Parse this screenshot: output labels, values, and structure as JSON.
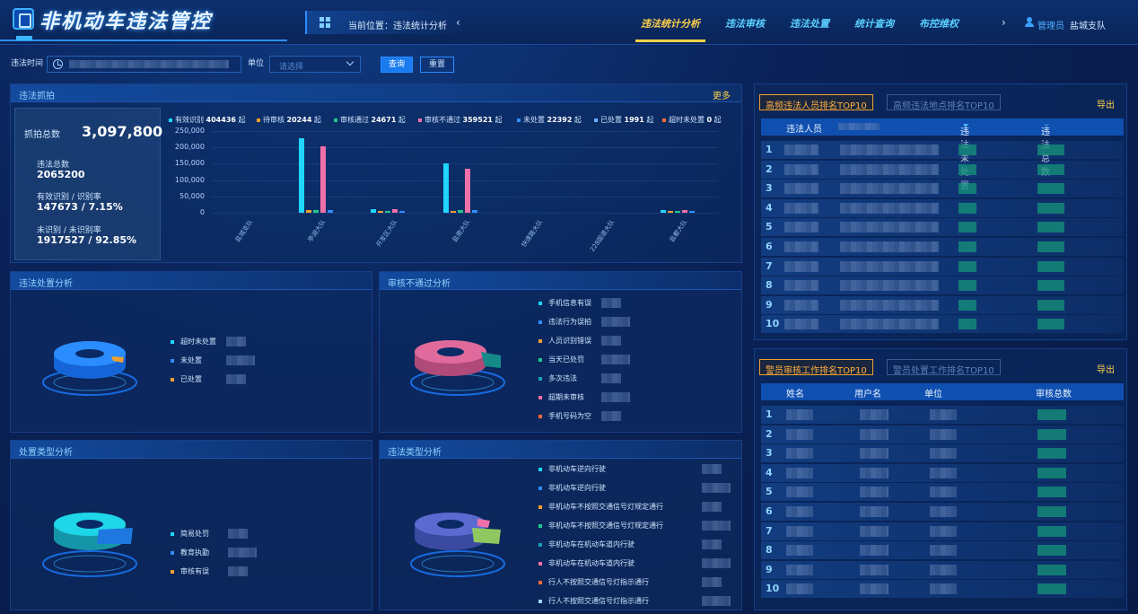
{
  "app": {
    "title": "非机动车违法管控"
  },
  "breadcrumb": {
    "label": "当前位置：",
    "current": "违法统计分析"
  },
  "nav": {
    "tabs": [
      "违法统计分析",
      "违法审核",
      "违法处置",
      "统计查询",
      "布控维权"
    ],
    "active": 0
  },
  "user": {
    "role": "管理员",
    "unit": "盐城支队"
  },
  "filters": {
    "time_label": "违法时间",
    "unit_label": "单位",
    "unit_placeholder": "请选择",
    "query": "查询",
    "reset": "重置"
  },
  "capture": {
    "title": "违法抓拍",
    "more": "更多",
    "total_label": "抓拍总数",
    "total": "3,097,800",
    "violations_label": "违法总数",
    "violations": "2065200",
    "valid_label": "有效识别 / 识别率",
    "valid": "147673 / 7.15%",
    "invalid_label": "未识别 / 未识别率",
    "invalid": "1917527 / 92.85%"
  },
  "chart_data": {
    "type": "bar",
    "categories": [
      "盐城支队",
      "亭湖大队",
      "开发区大队",
      "盐南大队",
      "快速路大队",
      "228国道大队",
      "盐都大队"
    ],
    "ylim": [
      0,
      250000
    ],
    "yticks": [
      "250,000",
      "200,000",
      "150,000",
      "100,000",
      "50,000",
      "0"
    ],
    "series": [
      {
        "name": "有效识别",
        "total": "404436",
        "unit": "起",
        "color": "#1ed6ff",
        "values": [
          0,
          228000,
          11000,
          152000,
          0,
          0,
          9000
        ]
      },
      {
        "name": "待审核",
        "total": "20244",
        "unit": "起",
        "color": "#f0a030",
        "values": [
          0,
          7000,
          1000,
          6000,
          0,
          0,
          1000
        ]
      },
      {
        "name": "审核通过",
        "total": "24671",
        "unit": "起",
        "color": "#20c890",
        "values": [
          0,
          9000,
          2000,
          8000,
          0,
          0,
          1500
        ]
      },
      {
        "name": "审核不通过",
        "total": "359521",
        "unit": "起",
        "color": "#f070a8",
        "values": [
          0,
          203000,
          10000,
          134000,
          0,
          0,
          8000
        ]
      },
      {
        "name": "未处置",
        "total": "22392",
        "unit": "起",
        "color": "#2e8cff",
        "values": [
          0,
          8000,
          2000,
          7000,
          0,
          0,
          1500
        ]
      },
      {
        "name": "已处置",
        "total": "1991",
        "unit": "起",
        "color": "#6ab0ff",
        "values": [
          0,
          800,
          200,
          700,
          0,
          0,
          200
        ]
      },
      {
        "name": "超时未处置",
        "total": "0",
        "unit": "起",
        "color": "#ff6a3a",
        "values": [
          0,
          0,
          0,
          0,
          0,
          0,
          0
        ]
      }
    ]
  },
  "disposal": {
    "title": "违法处置分析",
    "items": [
      {
        "label": "超时未处置",
        "color": "#1ed6ff"
      },
      {
        "label": "未处置",
        "color": "#2e8cff"
      },
      {
        "label": "已处置",
        "color": "#f0a030"
      }
    ]
  },
  "reject": {
    "title": "审核不通过分析",
    "items": [
      {
        "label": "手机信息有误",
        "color": "#1ed6ff"
      },
      {
        "label": "违法行为误拍",
        "color": "#2e8cff"
      },
      {
        "label": "人员识别错误",
        "color": "#f0a030"
      },
      {
        "label": "当天已处罚",
        "color": "#20c890"
      },
      {
        "label": "多次违法",
        "color": "#1aa0b8"
      },
      {
        "label": "超期未审核",
        "color": "#f070a8"
      },
      {
        "label": "手机号码为空",
        "color": "#ff6a3a"
      }
    ]
  },
  "dtype": {
    "title": "处置类型分析",
    "items": [
      {
        "label": "简易处罚",
        "color": "#1ed6ff"
      },
      {
        "label": "教育执勤",
        "color": "#2e8cff"
      },
      {
        "label": "审核有误",
        "color": "#f0a030"
      }
    ]
  },
  "vtype": {
    "title": "违法类型分析",
    "items": [
      {
        "label": "非机动车逆向行驶",
        "color": "#1ed6ff"
      },
      {
        "label": "非机动车逆向行驶",
        "color": "#2e8cff"
      },
      {
        "label": "非机动车不按照交通信号灯规定通行",
        "color": "#f0a030"
      },
      {
        "label": "非机动车不按照交通信号灯规定通行",
        "color": "#20c890"
      },
      {
        "label": "非机动车在机动车道内行驶",
        "color": "#1aa0b8"
      },
      {
        "label": "非机动车在机动车道内行驶",
        "color": "#f070a8"
      },
      {
        "label": "行人不按照交通信号灯指示通行",
        "color": "#ff6a3a"
      },
      {
        "label": "行人不按照交通信号灯指示通行",
        "color": "#9fd3ff"
      }
    ]
  },
  "rank1": {
    "tab1": "高频违法人员排名TOP10",
    "tab2": "高频违法地点排名TOP10",
    "export": "导出",
    "cols": [
      "违法人员",
      "违法未处置",
      "违法总数"
    ],
    "rows": [
      "1",
      "2",
      "3",
      "4",
      "5",
      "6",
      "7",
      "8",
      "9",
      "10"
    ]
  },
  "rank2": {
    "tab1": "警员审核工作排名TOP10",
    "tab2": "警员处置工作排名TOP10",
    "export": "导出",
    "cols": [
      "姓名",
      "用户名",
      "单位",
      "审核总数"
    ],
    "rows": [
      "1",
      "2",
      "3",
      "4",
      "5",
      "6",
      "7",
      "8",
      "9",
      "10"
    ]
  }
}
